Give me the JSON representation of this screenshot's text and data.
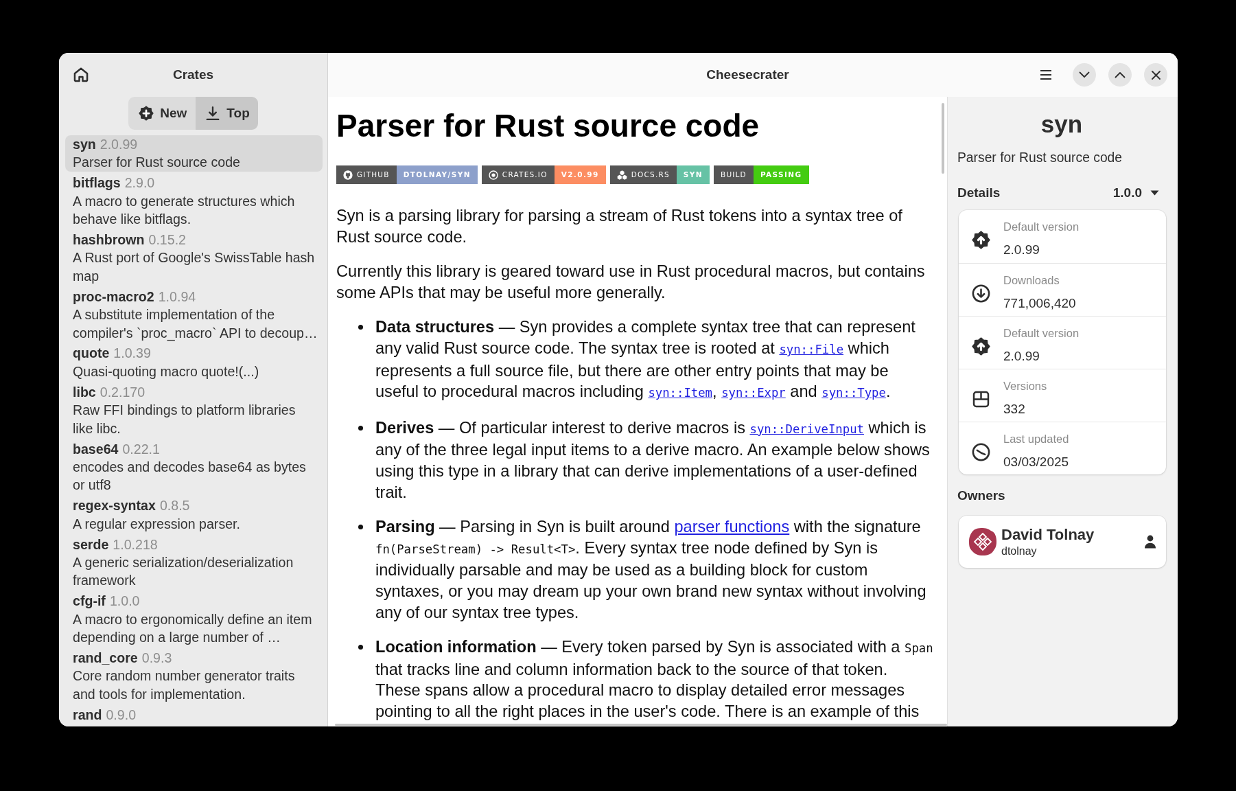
{
  "window": {
    "title": "Cheesecrater"
  },
  "sidebar": {
    "title": "Crates",
    "tabs": [
      {
        "label": "New",
        "selected": false
      },
      {
        "label": "Top",
        "selected": true
      }
    ],
    "crates": [
      {
        "name": "syn",
        "version": "2.0.99",
        "description": "Parser for Rust source code",
        "selected": true
      },
      {
        "name": "bitflags",
        "version": "2.9.0",
        "description": "A macro to generate structures which behave like bitflags.",
        "selected": false
      },
      {
        "name": "hashbrown",
        "version": "0.15.2",
        "description": "A Rust port of Google's SwissTable hash map",
        "selected": false
      },
      {
        "name": "proc-macro2",
        "version": "1.0.94",
        "description": "A substitute implementation of the compiler's `proc_macro` API to decoup…",
        "selected": false
      },
      {
        "name": "quote",
        "version": "1.0.39",
        "description": "Quasi-quoting macro quote!(...)",
        "selected": false
      },
      {
        "name": "libc",
        "version": "0.2.170",
        "description": "Raw FFI bindings to platform libraries like libc.",
        "selected": false
      },
      {
        "name": "base64",
        "version": "0.22.1",
        "description": "encodes and decodes base64 as bytes or utf8",
        "selected": false
      },
      {
        "name": "regex-syntax",
        "version": "0.8.5",
        "description": "A regular expression parser.",
        "selected": false
      },
      {
        "name": "serde",
        "version": "1.0.218",
        "description": "A generic serialization/deserialization framework",
        "selected": false
      },
      {
        "name": "cfg-if",
        "version": "1.0.0",
        "description": "A macro to ergonomically define an item depending on a large number of …",
        "selected": false
      },
      {
        "name": "rand_core",
        "version": "0.9.3",
        "description": "Core random number generator traits and tools for implementation.",
        "selected": false
      },
      {
        "name": "rand",
        "version": "0.9.0",
        "selected": false
      }
    ]
  },
  "readme": {
    "heading": "Parser for Rust source code",
    "badges": [
      {
        "kind": "github",
        "label": "GITHUB",
        "value": "DTOLNAY/SYN",
        "color": "#8da0cb"
      },
      {
        "kind": "crates",
        "label": "CRATES.IO",
        "value": "V2.0.99",
        "color": "#fc8d62"
      },
      {
        "kind": "docs",
        "label": "DOCS.RS",
        "value": "SYN",
        "color": "#66c2a5"
      },
      {
        "kind": "build",
        "label": "BUILD",
        "value": "PASSING",
        "color": "#44cc11"
      }
    ],
    "paragraphs": [
      "Syn is a parsing library for parsing a stream of Rust tokens into a syntax tree of Rust source code.",
      "Currently this library is geared toward use in Rust procedural macros, but contains some APIs that may be useful more generally."
    ],
    "list_items": [
      {
        "segments": [
          {
            "kind": "bold",
            "text": "Data structures"
          },
          {
            "kind": "text",
            "text": " — Syn provides a complete syntax tree that can represent any valid Rust source code. The syntax tree is rooted at "
          },
          {
            "kind": "code_link",
            "text": "syn::File"
          },
          {
            "kind": "text",
            "text": " which represents a full source file, but there are other entry points that may be useful to procedural macros including "
          },
          {
            "kind": "code_link",
            "text": "syn::Item"
          },
          {
            "kind": "text",
            "text": ", "
          },
          {
            "kind": "code_link",
            "text": "syn::Expr"
          },
          {
            "kind": "text",
            "text": " and "
          },
          {
            "kind": "code_link",
            "text": "syn::Type"
          },
          {
            "kind": "text",
            "text": "."
          }
        ]
      },
      {
        "segments": [
          {
            "kind": "bold",
            "text": "Derives"
          },
          {
            "kind": "text",
            "text": " — Of particular interest to derive macros is "
          },
          {
            "kind": "code_link",
            "text": "syn::DeriveInput"
          },
          {
            "kind": "text",
            "text": " which is any of the three legal input items to a derive macro. An example below shows using this type in a library that can derive implementations of a user-defined trait."
          }
        ]
      },
      {
        "segments": [
          {
            "kind": "bold",
            "text": "Parsing"
          },
          {
            "kind": "text",
            "text": " — Parsing in Syn is built around "
          },
          {
            "kind": "link",
            "text": "parser functions"
          },
          {
            "kind": "text",
            "text": " with the signature "
          },
          {
            "kind": "code",
            "text": "fn(ParseStream) -> Result<T>"
          },
          {
            "kind": "text",
            "text": ". Every syntax tree node defined by Syn is individually parsable and may be used as a building block for custom syntaxes, or you may dream up your own brand new syntax without involving any of our syntax tree types."
          }
        ]
      },
      {
        "segments": [
          {
            "kind": "bold",
            "text": "Location information"
          },
          {
            "kind": "text",
            "text": " — Every token parsed by Syn is associated with a "
          },
          {
            "kind": "code",
            "text": "Span"
          },
          {
            "kind": "text",
            "text": " that tracks line and column information back to the source of that token. These spans allow a procedural macro to display detailed error messages pointing to all the right places in the user's code. There is an example of this"
          }
        ]
      }
    ]
  },
  "details": {
    "title": "syn",
    "summary": "Parser for Rust source code",
    "section_title": "Details",
    "version": "1.0.0",
    "rows": [
      {
        "kind": "version",
        "label": "Default version",
        "value": "2.0.99"
      },
      {
        "kind": "downloads",
        "label": "Downloads",
        "value": "771,006,420"
      },
      {
        "kind": "version",
        "label": "Default version",
        "value": "2.0.99"
      },
      {
        "kind": "versions",
        "label": "Versions",
        "value": "332"
      },
      {
        "kind": "updated",
        "label": "Last updated",
        "value": "03/03/2025"
      }
    ],
    "owners_title": "Owners",
    "owners": [
      {
        "name": "David Tolnay",
        "login": "dtolnay"
      }
    ]
  }
}
